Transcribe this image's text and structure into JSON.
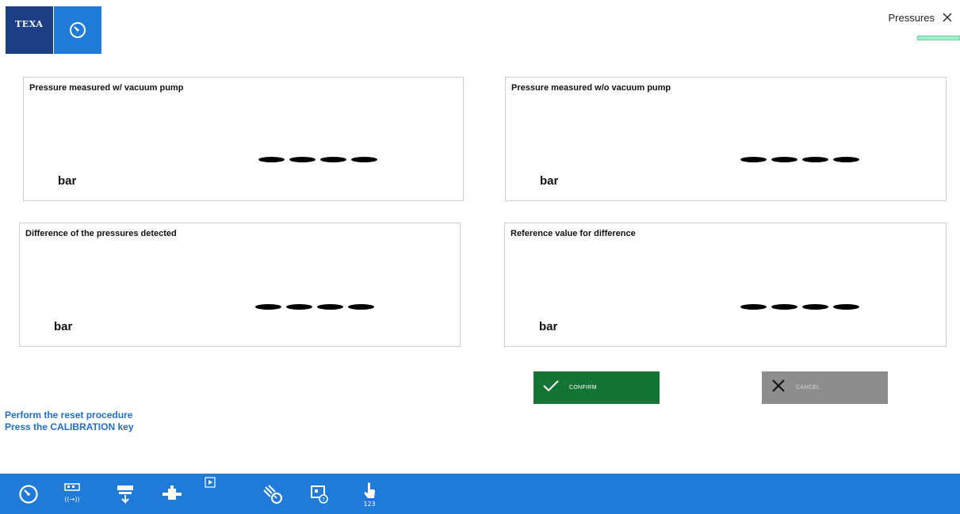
{
  "header": {
    "logo_text": "TEXA",
    "title": "Pressures",
    "progress_percent": 100,
    "accent_color": "#1f7ad8",
    "brand_color": "#1d3f86"
  },
  "panels": [
    {
      "title": "Pressure measured w/ vacuum pump",
      "value": "----",
      "unit": "bar"
    },
    {
      "title": "Pressure measured w/o vacuum pump",
      "value": "----",
      "unit": "bar"
    },
    {
      "title": "Difference of the pressures detected",
      "value": "----",
      "unit": "bar"
    },
    {
      "title": "Reference value for difference",
      "value": "----",
      "unit": "bar"
    }
  ],
  "buttons": {
    "confirm_label": "CONFIRM",
    "cancel_label": "CANCEL",
    "confirm_color": "#137434",
    "cancel_color": "#8d8d8d"
  },
  "instructions": {
    "line1": "Perform the reset procedure",
    "line2": "Press the CALIBRATION key"
  },
  "toolbar": {
    "icons": [
      "gauge-icon",
      "remote-control-icon",
      "download-icon",
      "plug-icon",
      "play-icon",
      "diagnosis-icon",
      "help-screen-icon",
      "touch-keypad-icon"
    ],
    "keypad_label": "123"
  }
}
